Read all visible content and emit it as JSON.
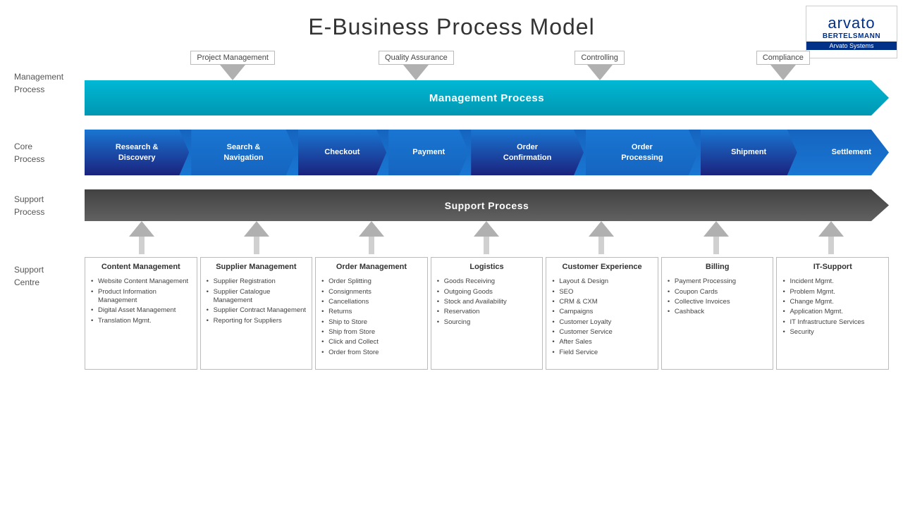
{
  "title": "E-Business Process Model",
  "logo": {
    "arvato": "arvato",
    "bertelsmann": "BERTELSMANN",
    "systems": "Arvato Systems"
  },
  "management": {
    "label": "Management\nProcess",
    "bar_text": "Management Process",
    "arrows": [
      "Project Management",
      "Quality Assurance",
      "Controlling",
      "Compliance"
    ]
  },
  "core": {
    "label": "Core\nProcess",
    "steps": [
      {
        "label": "Research &\nDiscovery"
      },
      {
        "label": "Search &\nNavigation"
      },
      {
        "label": "Checkout"
      },
      {
        "label": "Payment"
      },
      {
        "label": "Order\nConfirmation"
      },
      {
        "label": "Order\nProcessing"
      },
      {
        "label": "Shipment"
      },
      {
        "label": "Settlement"
      }
    ]
  },
  "support": {
    "label": "Support\nProcess",
    "bar_text": "Support Process"
  },
  "support_centre": {
    "label": "Support\nCentre",
    "cards": [
      {
        "title": "Content\nManagement",
        "items": [
          "Website Content Management",
          "Product Information Management",
          "Digital Asset Management",
          "Translation Mgmt."
        ]
      },
      {
        "title": "Supplier\nManagement",
        "items": [
          "Supplier Registration",
          "Supplier Catalogue Management",
          "Supplier Contract Management",
          "Reporting for Suppliers"
        ]
      },
      {
        "title": "Order\nManagement",
        "items": [
          "Order Splitting",
          "Consignments",
          "Cancellations",
          "Returns",
          "Ship to Store",
          "Ship from Store",
          "Click and Collect",
          "Order from Store"
        ]
      },
      {
        "title": "Logistics",
        "items": [
          "Goods Receiving",
          "Outgoing Goods",
          "Stock and Availability",
          "Reservation",
          "Sourcing"
        ]
      },
      {
        "title": "Customer\nExperience",
        "items": [
          "Layout & Design",
          "SEO",
          "CRM & CXM",
          "Campaigns",
          "Customer Loyalty",
          "Customer Service",
          "After Sales",
          "Field Service"
        ]
      },
      {
        "title": "Billing",
        "items": [
          "Payment Processing",
          "Coupon Cards",
          "Collective Invoices",
          "Cashback"
        ]
      },
      {
        "title": "IT-Support",
        "items": [
          "Incident Mgmt.",
          "Problem Mgmt.",
          "Change Mgmt.",
          "Application Mgmt.",
          "IT Infrastructure Services",
          "Security"
        ]
      }
    ]
  }
}
